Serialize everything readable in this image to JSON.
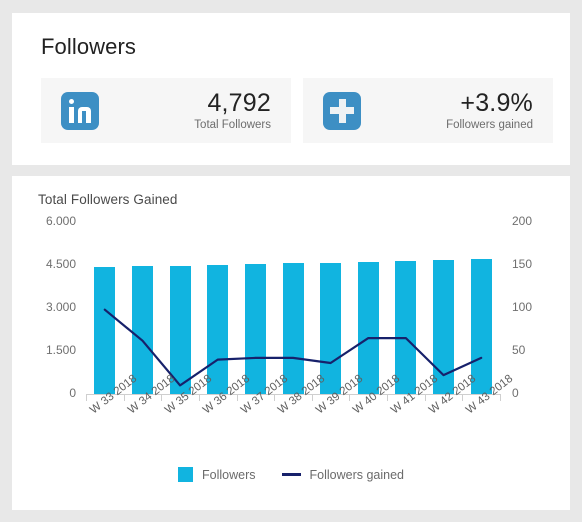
{
  "followers_card": {
    "title": "Followers",
    "stats": [
      {
        "icon": "linkedin-icon",
        "value": "4,792",
        "label": "Total Followers"
      },
      {
        "icon": "plus-icon",
        "value": "+3.9%",
        "label": "Followers gained"
      }
    ]
  },
  "chart_card": {
    "title": "Total Followers Gained"
  },
  "colors": {
    "bar": "#11b4e0",
    "line": "#17216b",
    "icon_blue": "#3d8fc4",
    "page_background": "#e8e8e8",
    "card_background": "#ffffff",
    "tile_background": "#f6f6f6"
  },
  "chart_data": {
    "type": "bar",
    "title": "Total Followers Gained",
    "xlabel": "",
    "ylabel": "",
    "grid": false,
    "legend_position": "bottom",
    "categories": [
      "W 33 2018",
      "W 34 2018",
      "W 35 2018",
      "W 36 2018",
      "W 37 2018",
      "W 38 2018",
      "W 39 2018",
      "W 40 2018",
      "W 41 2018",
      "W 42 2018",
      "W 43 2018"
    ],
    "y_axis_left": {
      "ticks": [
        "0",
        "1.500",
        "3.000",
        "4.500",
        "6.000"
      ],
      "values": [
        0,
        1500,
        3000,
        4500,
        6000
      ],
      "ylim": [
        0,
        6000
      ]
    },
    "y_axis_right": {
      "ticks": [
        "0",
        "50",
        "100",
        "150",
        "200"
      ],
      "values": [
        0,
        50,
        100,
        150,
        200
      ],
      "ylim": [
        0,
        200
      ]
    },
    "series": [
      {
        "name": "Followers",
        "type": "bar",
        "axis": "left",
        "color": "#11b4e0",
        "values": [
          4430,
          4470,
          4480,
          4510,
          4540,
          4560,
          4580,
          4620,
          4640,
          4680,
          4720
        ]
      },
      {
        "name": "Followers gained",
        "type": "line",
        "axis": "right",
        "color": "#17216b",
        "values": [
          98,
          62,
          10,
          40,
          42,
          42,
          36,
          65,
          65,
          22,
          42
        ]
      }
    ],
    "legend": [
      "Followers",
      "Followers gained"
    ]
  }
}
